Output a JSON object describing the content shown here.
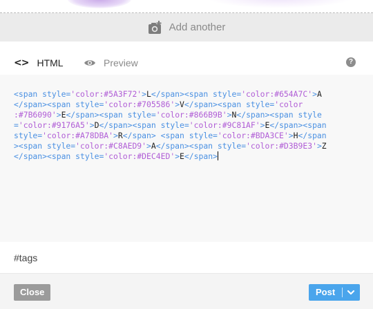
{
  "add_another": {
    "label": "Add another",
    "icon": "camera-plus-icon"
  },
  "editor_tabs": [
    {
      "label": "HTML",
      "icon": "code-brackets-icon",
      "active": true
    },
    {
      "label": "Preview",
      "icon": "eye-icon",
      "active": false
    }
  ],
  "help": {
    "icon": "help-icon",
    "glyph": "?"
  },
  "code": {
    "lines": [
      [
        {
          "t": "<span style=",
          "c": "#4a90e2"
        },
        {
          "t": "'color:#5A3F72'",
          "c": "#b05dd6"
        },
        {
          "t": ">",
          "c": "#4a90e2"
        },
        {
          "t": "L",
          "c": "#1d1d1d"
        },
        {
          "t": "</span><span style=",
          "c": "#4a90e2"
        },
        {
          "t": "'color:#654A7C'",
          "c": "#b05dd6"
        },
        {
          "t": ">",
          "c": "#4a90e2"
        },
        {
          "t": "A",
          "c": "#1d1d1d"
        }
      ],
      [
        {
          "t": "</span><span style=",
          "c": "#4a90e2"
        },
        {
          "t": "'color:#705586'",
          "c": "#b05dd6"
        },
        {
          "t": ">",
          "c": "#4a90e2"
        },
        {
          "t": "V",
          "c": "#1d1d1d"
        },
        {
          "t": "</span><span style=",
          "c": "#4a90e2"
        },
        {
          "t": "'color",
          "c": "#b05dd6"
        }
      ],
      [
        {
          "t": ":#7B6090'",
          "c": "#b05dd6"
        },
        {
          "t": ">",
          "c": "#4a90e2"
        },
        {
          "t": "E",
          "c": "#1d1d1d"
        },
        {
          "t": "</span><span style=",
          "c": "#4a90e2"
        },
        {
          "t": "'color:#866B9B'",
          "c": "#b05dd6"
        },
        {
          "t": ">",
          "c": "#4a90e2"
        },
        {
          "t": "N",
          "c": "#1d1d1d"
        },
        {
          "t": "</span><span style",
          "c": "#4a90e2"
        }
      ],
      [
        {
          "t": "=",
          "c": "#4a90e2"
        },
        {
          "t": "'color:#9176A5'",
          "c": "#b05dd6"
        },
        {
          "t": ">",
          "c": "#4a90e2"
        },
        {
          "t": "D",
          "c": "#1d1d1d"
        },
        {
          "t": "</span><span style=",
          "c": "#4a90e2"
        },
        {
          "t": "'color:#9C81AF'",
          "c": "#b05dd6"
        },
        {
          "t": ">",
          "c": "#4a90e2"
        },
        {
          "t": "E",
          "c": "#1d1d1d"
        },
        {
          "t": "</span><span",
          "c": "#4a90e2"
        }
      ],
      [
        {
          "t": "style=",
          "c": "#4a90e2"
        },
        {
          "t": "'color:#A78DBA'",
          "c": "#b05dd6"
        },
        {
          "t": ">",
          "c": "#4a90e2"
        },
        {
          "t": "R",
          "c": "#1d1d1d"
        },
        {
          "t": "</span> <span style=",
          "c": "#4a90e2"
        },
        {
          "t": "'color:#BDA3CE'",
          "c": "#b05dd6"
        },
        {
          "t": ">",
          "c": "#4a90e2"
        },
        {
          "t": "H",
          "c": "#1d1d1d"
        },
        {
          "t": "</span",
          "c": "#4a90e2"
        }
      ],
      [
        {
          "t": "><span style=",
          "c": "#4a90e2"
        },
        {
          "t": "'color:#C8AED9'",
          "c": "#b05dd6"
        },
        {
          "t": ">",
          "c": "#4a90e2"
        },
        {
          "t": "A",
          "c": "#1d1d1d"
        },
        {
          "t": "</span><span style=",
          "c": "#4a90e2"
        },
        {
          "t": "'color:#D3B9E3'",
          "c": "#b05dd6"
        },
        {
          "t": ">",
          "c": "#4a90e2"
        },
        {
          "t": "Z",
          "c": "#1d1d1d"
        }
      ],
      [
        {
          "t": "</span><span style=",
          "c": "#4a90e2"
        },
        {
          "t": "'color:#DEC4ED'",
          "c": "#b05dd6"
        },
        {
          "t": ">",
          "c": "#4a90e2"
        },
        {
          "t": "E",
          "c": "#1d1d1d"
        },
        {
          "t": "</span>",
          "c": "#4a90e2"
        }
      ]
    ]
  },
  "tags": {
    "placeholder": "#tags",
    "value": ""
  },
  "footer": {
    "close_label": "Close",
    "post_label": "Post",
    "post_menu_icon": "chevron-down-icon"
  },
  "colors": {
    "accent": "#4aa5ec",
    "close_button": "#9b9b9b",
    "tag_color": "#4a90e2",
    "attr_color": "#b05dd6"
  }
}
